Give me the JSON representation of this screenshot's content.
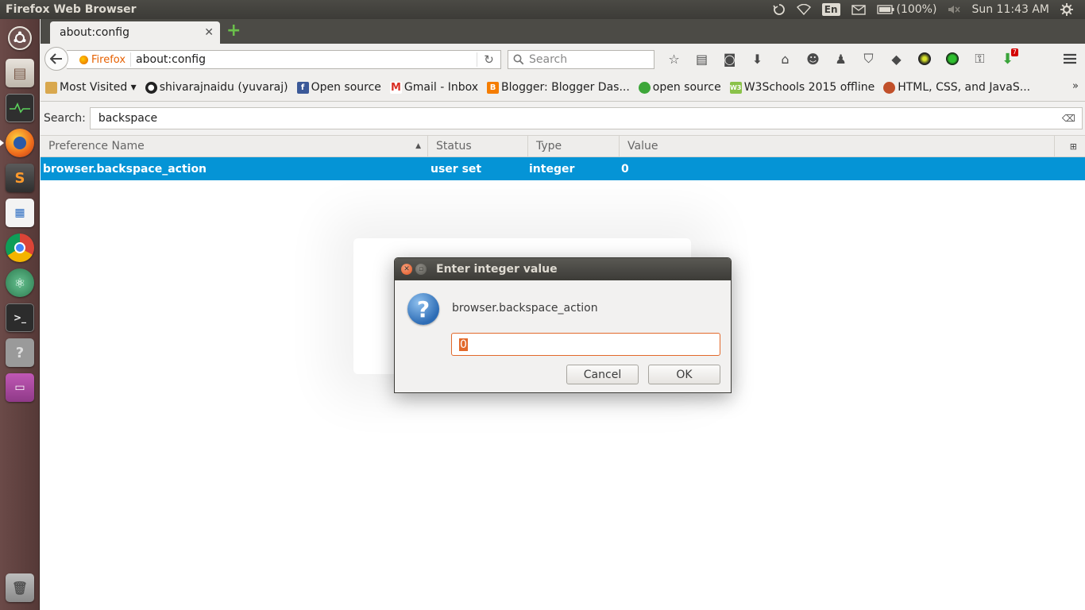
{
  "top_panel": {
    "window_title": "Firefox Web Browser",
    "keyboard_layout": "En",
    "battery": "(100%)",
    "clock": "Sun 11:43 AM"
  },
  "launcher": {
    "items": [
      "dash-home",
      "files",
      "system-monitor",
      "firefox",
      "sublime-text",
      "libreoffice-writer",
      "chrome",
      "atom",
      "terminal",
      "help",
      "software-center",
      "trash"
    ]
  },
  "browser": {
    "tab": {
      "title": "about:config"
    },
    "urlbar": {
      "identity": "Firefox",
      "url": "about:config"
    },
    "searchbar": {
      "placeholder": "Search"
    },
    "toolbar_badge": "7",
    "bookmarks": [
      {
        "label": "Most Visited ▾",
        "icon": "folder-icon"
      },
      {
        "label": "shivarajnaidu (yuvaraj)",
        "icon": "github-icon"
      },
      {
        "label": "Open source",
        "icon": "facebook-icon"
      },
      {
        "label": "Gmail - Inbox",
        "icon": "gmail-icon"
      },
      {
        "label": "Blogger: Blogger Das...",
        "icon": "blogger-icon"
      },
      {
        "label": "open source",
        "icon": "opensource-icon"
      },
      {
        "label": "W3Schools 2015 offline",
        "icon": "w3schools-icon"
      },
      {
        "label": "HTML, CSS, and JavaS...",
        "icon": "mdn-icon"
      }
    ],
    "bookmarks_overflow": "»"
  },
  "config": {
    "search_label": "Search:",
    "search_value": "backspace",
    "columns": [
      "Preference Name",
      "Status",
      "Type",
      "Value"
    ],
    "rows": [
      {
        "name": "browser.backspace_action",
        "status": "user set",
        "type": "integer",
        "value": "0"
      }
    ]
  },
  "dialog": {
    "title": "Enter integer value",
    "message": "browser.backspace_action",
    "input_value": "0",
    "cancel_label": "Cancel",
    "ok_label": "OK"
  },
  "colors": {
    "selection": "#0594d6",
    "ubuntu_orange": "#e2692b",
    "panel": "#3c3b37"
  }
}
